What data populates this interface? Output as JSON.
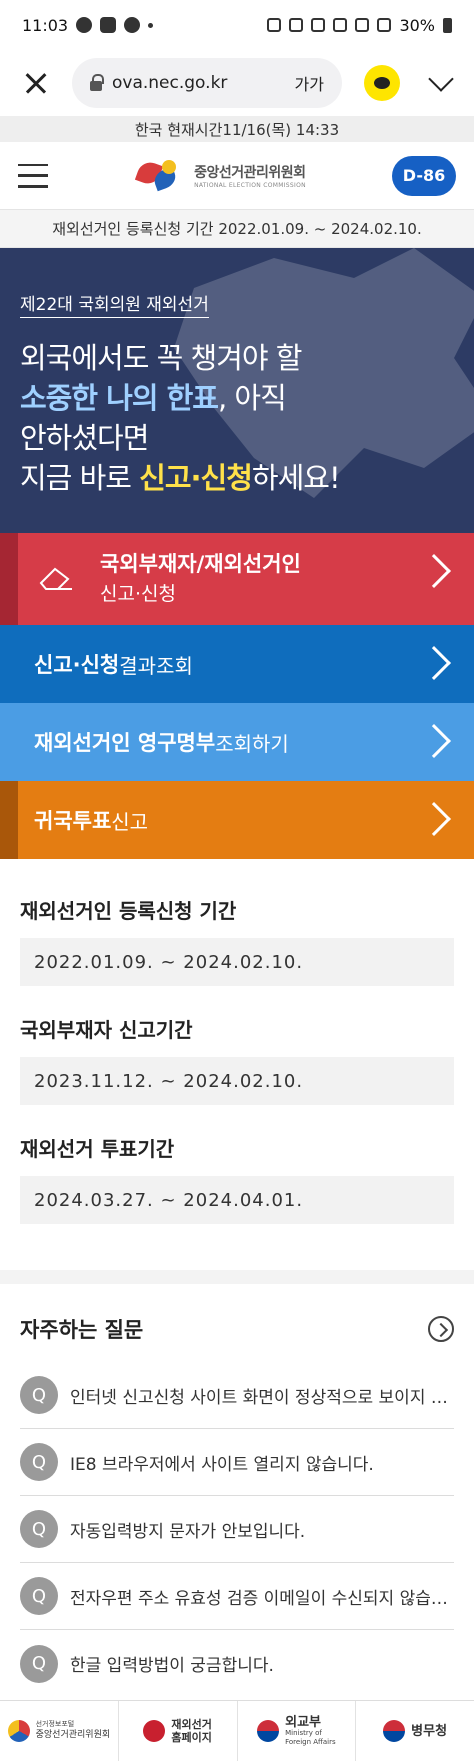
{
  "status_bar": {
    "time": "11:03",
    "battery": "30%"
  },
  "browser": {
    "url": "ova.nec.go.kr",
    "text_size_label": "가가"
  },
  "time_bar": "한국 현재시간11/16(목) 14:33",
  "header": {
    "logo_ko": "중앙선거관리위원회",
    "logo_en": "NATIONAL ELECTION COMMISSION",
    "dday": "D-86"
  },
  "period_notice": "재외선거인 등록신청 기간 2022.01.09. ~ 2024.02.10.",
  "hero": {
    "subtitle": "제22대 국회의원 재외선거",
    "line1": "외국에서도 꼭 챙겨야 할",
    "line2_blue": "소중한 나의 한표",
    "line2_rest": ", 아직",
    "line3": "안하셨다면",
    "line4_pre": "지금 바로 ",
    "line4_yellow": "신고·신청",
    "line4_post": "하세요!"
  },
  "actions": [
    {
      "bold": "국외부재자/재외선거인",
      "regular": "신고·신청",
      "color": "#d63c48"
    },
    {
      "bold": "신고·신청",
      "regular": " 결과조회",
      "color": "#0f6dbd"
    },
    {
      "bold": "재외선거인 영구명부",
      "regular": " 조회하기",
      "color": "#4b9de4"
    },
    {
      "bold": "귀국투표",
      "regular": " 신고",
      "color": "#e47d12"
    }
  ],
  "periods": [
    {
      "label": "재외선거인 등록신청 기간",
      "value": "2022.01.09. ~ 2024.02.10."
    },
    {
      "label": "국외부재자 신고기간",
      "value": "2023.11.12. ~ 2024.02.10."
    },
    {
      "label": "재외선거 투표기간",
      "value": "2024.03.27. ~ 2024.04.01."
    }
  ],
  "faq": {
    "title": "자주하는 질문",
    "badge": "Q",
    "items": [
      "인터넷 신고신청 사이트 화면이 정상적으로 보이지 않습니다.",
      "IE8 브라우저에서 사이트 열리지 않습니다.",
      "자동입력방지 문자가 안보입니다.",
      "전자우편 주소 유효성 검증 이메일이 수신되지 않습니다.",
      "한글 입력방법이 궁금합니다."
    ]
  },
  "footer": {
    "nec_small": "선거정보포털",
    "nec": "중앙선거관리위원회",
    "ova_1": "재외선거",
    "ova_2": "홈페이지",
    "mofa": "외교부",
    "mofa_en_1": "Ministry of",
    "mofa_en_2": "Foreign Affairs",
    "mma": "병무청"
  }
}
